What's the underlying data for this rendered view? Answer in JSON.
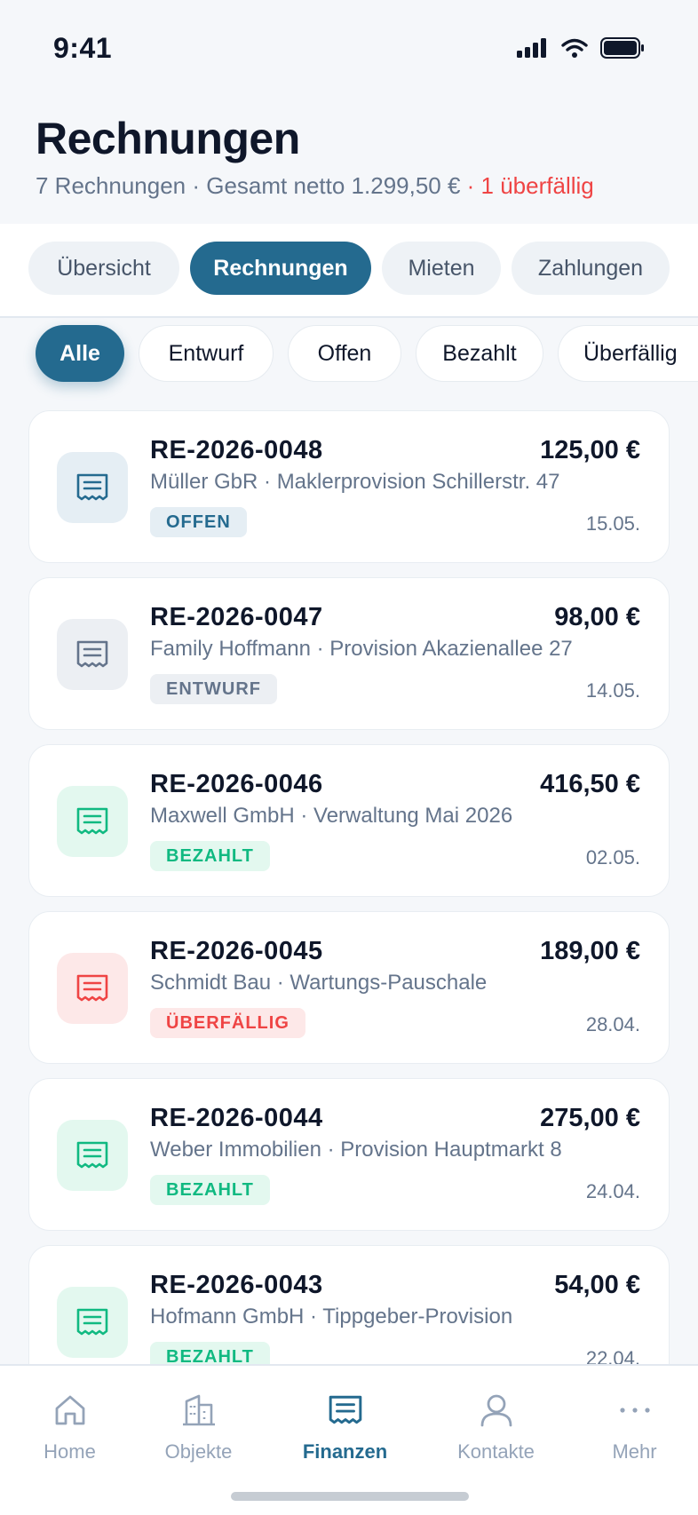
{
  "status": {
    "time": "9:41"
  },
  "header": {
    "title": "Rechnungen",
    "subtitle": "7 Rechnungen · Gesamt netto 1.299,50 €",
    "overdue": " · 1 überfällig"
  },
  "tabs": [
    {
      "label": "Übersicht",
      "active": false
    },
    {
      "label": "Rechnungen",
      "active": true
    },
    {
      "label": "Mieten",
      "active": false
    },
    {
      "label": "Zahlungen",
      "active": false
    }
  ],
  "filters": [
    {
      "label": "Alle",
      "active": true
    },
    {
      "label": "Entwurf",
      "active": false
    },
    {
      "label": "Offen",
      "active": false
    },
    {
      "label": "Bezahlt",
      "active": false
    },
    {
      "label": "Überfällig",
      "active": false
    }
  ],
  "invoices": [
    {
      "number": "RE-2026-0048",
      "amount": "125,00 €",
      "description": "Müller GbR · Maklerprovision Schillerstr. 47",
      "status": "OFFEN",
      "date": "15.05."
    },
    {
      "number": "RE-2026-0047",
      "amount": "98,00 €",
      "description": "Family Hoffmann · Provision Akazienallee 27",
      "status": "ENTWURF",
      "date": "14.05."
    },
    {
      "number": "RE-2026-0046",
      "amount": "416,50 €",
      "description": "Maxwell GmbH · Verwaltung Mai 2026",
      "status": "BEZAHLT",
      "date": "02.05."
    },
    {
      "number": "RE-2026-0045",
      "amount": "189,00 €",
      "description": "Schmidt Bau · Wartungs-Pauschale",
      "status": "ÜBERFÄLLIG",
      "date": "28.04."
    },
    {
      "number": "RE-2026-0044",
      "amount": "275,00 €",
      "description": "Weber Immobilien · Provision Hauptmarkt 8",
      "status": "BEZAHLT",
      "date": "24.04."
    },
    {
      "number": "RE-2026-0043",
      "amount": "54,00 €",
      "description": "Hofmann GmbH · Tippgeber-Provision",
      "status": "BEZAHLT",
      "date": "22.04."
    }
  ],
  "status_colors": {
    "open": {
      "bg": "#e5eef4",
      "fg": "#246a8f",
      "icon": "#246a8f"
    },
    "draft": {
      "bg": "#eceff3",
      "fg": "#64748b",
      "icon": "#64748b"
    },
    "paid": {
      "bg": "#e3f8ef",
      "fg": "#10b981",
      "icon": "#10b981"
    },
    "overdue": {
      "bg": "#fde8e8",
      "fg": "#ef4444",
      "icon": "#ef4444"
    }
  },
  "nav": [
    {
      "label": "Home",
      "icon": "home-icon",
      "active": false
    },
    {
      "label": "Objekte",
      "icon": "building-icon",
      "active": false
    },
    {
      "label": "Finanzen",
      "icon": "invoice-icon",
      "active": true
    },
    {
      "label": "Kontakte",
      "icon": "person-icon",
      "active": false
    },
    {
      "label": "Mehr",
      "icon": "more-icon",
      "active": false
    }
  ],
  "colors": {
    "accent": "#246a8f",
    "danger": "#ef4444",
    "muted": "#94a3b8"
  }
}
